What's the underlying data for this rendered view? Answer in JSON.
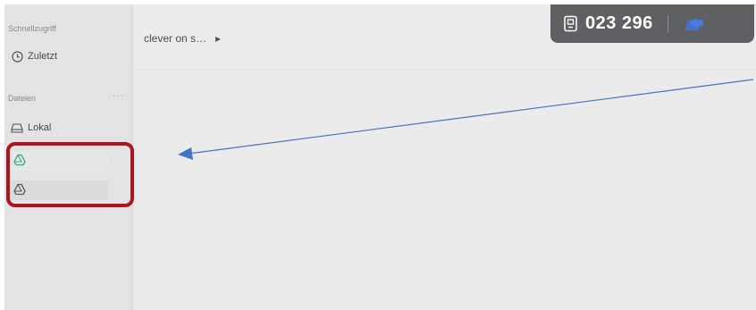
{
  "sidebar": {
    "quick_access_title": "Schnellzugriff",
    "recent_label": "Zuletzt",
    "files_title": "Dateien",
    "files_more": "···",
    "local_label": "Lokal",
    "drives": [
      {
        "label": "",
        "icon": "drive-icon",
        "color": "#3aa87c"
      },
      {
        "label": "",
        "icon": "drive-icon",
        "color": "#5a5a5a"
      }
    ]
  },
  "main": {
    "breadcrumb": "clever on s…",
    "breadcrumb_arrow": "▶"
  },
  "overlay": {
    "code": "023 296"
  },
  "annotation": {
    "highlight_color": "#b0131b",
    "arrow_color": "#4472c4"
  }
}
